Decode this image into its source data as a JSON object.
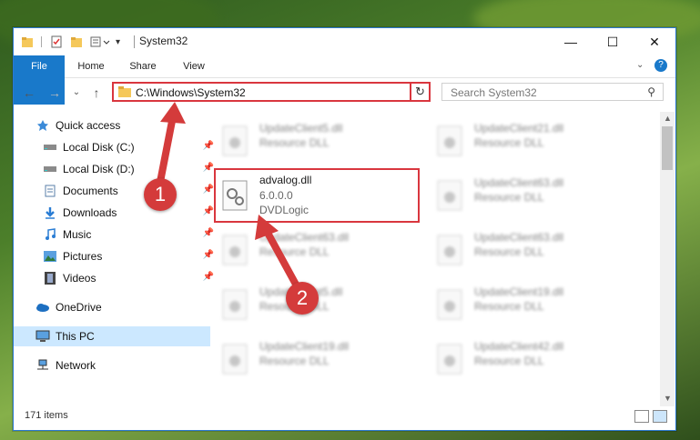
{
  "window": {
    "title": "System32",
    "controls": {
      "minimize": "—",
      "maximize": "☐",
      "close": "✕"
    }
  },
  "ribbon": {
    "tabs": [
      "File",
      "Home",
      "Share",
      "View"
    ]
  },
  "address": {
    "path": "C:\\Windows\\System32",
    "dropdown": "⌄",
    "refresh": "↻",
    "search_placeholder": "Search System32"
  },
  "nav": {
    "items": [
      {
        "label": "Quick access",
        "icon": "star-icon"
      },
      {
        "label": "Local Disk (C:)",
        "icon": "drive-icon",
        "pinned": true
      },
      {
        "label": "Local Disk (D:)",
        "icon": "drive-icon",
        "pinned": true
      },
      {
        "label": "Documents",
        "icon": "documents-icon",
        "pinned": true
      },
      {
        "label": "Downloads",
        "icon": "download-icon",
        "pinned": true
      },
      {
        "label": "Music",
        "icon": "music-icon",
        "pinned": true
      },
      {
        "label": "Pictures",
        "icon": "pictures-icon",
        "pinned": true
      },
      {
        "label": "Videos",
        "icon": "videos-icon",
        "pinned": true
      },
      {
        "label": "OneDrive",
        "icon": "cloud-icon"
      },
      {
        "label": "This PC",
        "icon": "computer-icon",
        "selected": true
      },
      {
        "label": "Network",
        "icon": "network-icon"
      }
    ]
  },
  "files": {
    "highlighted": {
      "name": "advalog.dll",
      "version": "6.0.0.0",
      "company": "DVDLogic"
    },
    "blurred": [
      {
        "name": "UpdateClient5.dll",
        "type": "Resource DLL"
      },
      {
        "name": "UpdateClient21.dll",
        "type": "Resource DLL"
      },
      {
        "name": "UpdateClient63.dll",
        "type": "Resource DLL"
      },
      {
        "name": "UpdateClient63.dll",
        "type": "Resource DLL"
      },
      {
        "name": "UpdateClient63.dll",
        "type": "Resource DLL"
      },
      {
        "name": "UpdateClient5.dll",
        "type": "Resource DLL"
      },
      {
        "name": "UpdateClient19.dll",
        "type": "Resource DLL"
      },
      {
        "name": "UpdateClient19.dll",
        "type": "Resource DLL"
      },
      {
        "name": "UpdateClient42.dll",
        "type": "Resource DLL"
      }
    ]
  },
  "status": {
    "count": "171 items"
  },
  "annotations": {
    "step1": "1",
    "step2": "2"
  },
  "colors": {
    "accent": "#1979ca",
    "highlight": "#d9363e"
  }
}
